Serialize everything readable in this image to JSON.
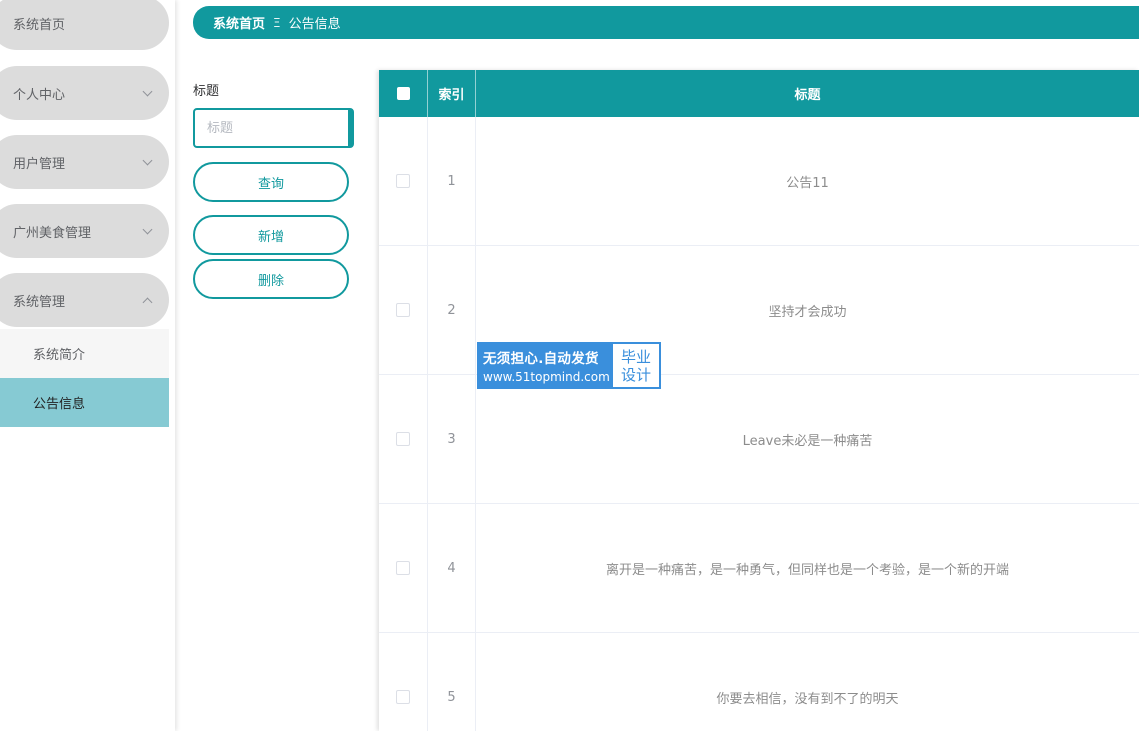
{
  "sidebar": {
    "menu": [
      {
        "label": "系统首页",
        "chevron": "none"
      },
      {
        "label": "个人中心",
        "chevron": "down"
      },
      {
        "label": "用户管理",
        "chevron": "down"
      },
      {
        "label": "广州美食管理",
        "chevron": "down"
      },
      {
        "label": "系统管理",
        "chevron": "up"
      }
    ],
    "submenu": [
      {
        "label": "系统简介",
        "active": false
      },
      {
        "label": "公告信息",
        "active": true
      }
    ]
  },
  "breadcrumb": {
    "home": "系统首页",
    "separator": "Ξ",
    "current": "公告信息"
  },
  "search": {
    "field_label": "标题",
    "placeholder": "标题",
    "value": ""
  },
  "actions": {
    "query": "查询",
    "add": "新增",
    "delete": "删除"
  },
  "table": {
    "columns": {
      "index": "索引",
      "title": "标题"
    },
    "rows": [
      {
        "index": "1",
        "title": "公告11"
      },
      {
        "index": "2",
        "title": "坚持才会成功"
      },
      {
        "index": "3",
        "title": "Leave未必是一种痛苦"
      },
      {
        "index": "4",
        "title": "离开是一种痛苦，是一种勇气，但同样也是一个考验，是一个新的开端"
      },
      {
        "index": "5",
        "title": "你要去相信，没有到不了的明天"
      }
    ]
  },
  "watermark": {
    "line1": "无须担心.自动发货",
    "line2": "www.51topmind.com",
    "badge_line1": "毕业",
    "badge_line2": "设计"
  },
  "colors": {
    "accent": "#11999e",
    "sidebar_pill": "#dcdcdc",
    "active_submenu": "#86cad3",
    "watermark_blue": "#3a8fdc"
  }
}
